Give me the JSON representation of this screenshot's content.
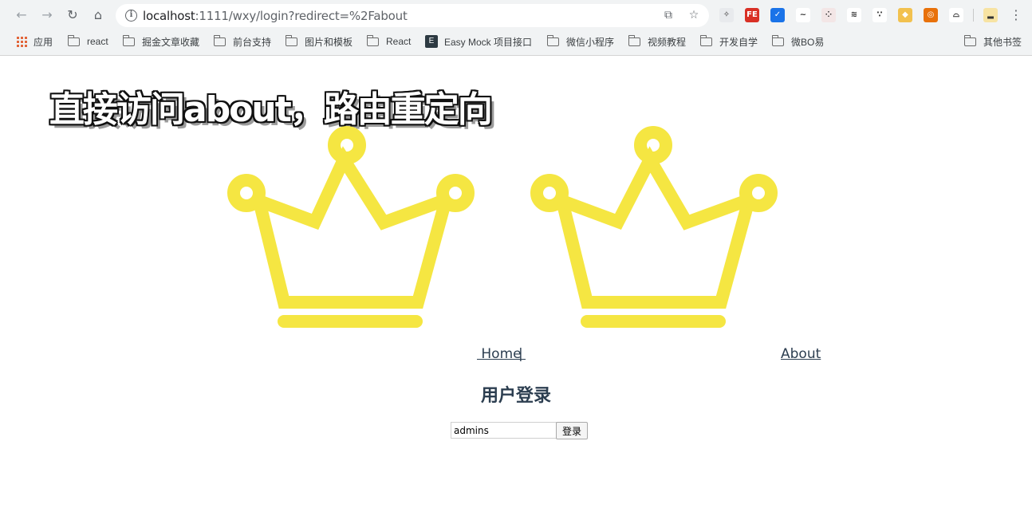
{
  "browser": {
    "url_host": "localhost",
    "url_rest": ":1111/wxy/login?redirect=%2Fabout",
    "bookmarks": [
      {
        "label": "应用",
        "icon": "apps-icon"
      },
      {
        "label": "react",
        "icon": "folder-icon"
      },
      {
        "label": "掘金文章收藏",
        "icon": "folder-icon"
      },
      {
        "label": "前台支持",
        "icon": "folder-icon"
      },
      {
        "label": "图片和模板",
        "icon": "folder-icon"
      },
      {
        "label": "React",
        "icon": "folder-icon"
      },
      {
        "label": "Easy Mock 项目接口",
        "icon": "easy-mock-icon"
      },
      {
        "label": "微信小程序",
        "icon": "folder-icon"
      },
      {
        "label": "视频教程",
        "icon": "folder-icon"
      },
      {
        "label": "开发自学",
        "icon": "folder-icon"
      },
      {
        "label": "微BO易",
        "icon": "folder-icon"
      },
      {
        "label": "其他书签",
        "icon": "folder-icon"
      }
    ],
    "extensions": [
      {
        "name": "ext-react-icon",
        "color": "#e8eaed",
        "glyph": "✧"
      },
      {
        "name": "ext-fe-icon",
        "color": "#d93025",
        "glyph": "FE"
      },
      {
        "name": "ext-shield-icon",
        "color": "#1a73e8",
        "glyph": "✓"
      },
      {
        "name": "ext-gif-icon",
        "color": "#ffffff",
        "glyph": "~"
      },
      {
        "name": "ext-grid-icon",
        "color": "#f3e6e6",
        "glyph": "⁘"
      },
      {
        "name": "ext-fish-icon",
        "color": "#ffffff",
        "glyph": "≋"
      },
      {
        "name": "ext-dots-icon",
        "color": "#ffffff",
        "glyph": "∵"
      },
      {
        "name": "ext-puzzle-icon",
        "color": "#f2c14e",
        "glyph": "◆"
      },
      {
        "name": "ext-ring-icon",
        "color": "#e8710a",
        "glyph": "◎"
      },
      {
        "name": "ext-parachute-icon",
        "color": "#ffffff",
        "glyph": "⌓"
      },
      {
        "name": "ext-cake-icon",
        "color": "#f7e3a3",
        "glyph": "▂"
      }
    ]
  },
  "overlay": {
    "caption": "直接访问about，路由重定向"
  },
  "colors": {
    "crown": "#f5e642",
    "text": "#2c3e50"
  },
  "nav": {
    "home": " Home ",
    "separator": "|",
    "about": "About"
  },
  "login": {
    "title": "用户登录",
    "username_value": "admins",
    "submit_label": "登录"
  }
}
